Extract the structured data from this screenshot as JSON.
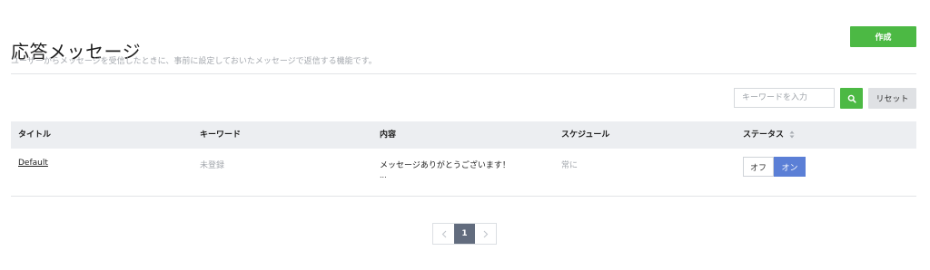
{
  "header": {
    "title": "応答メッセージ",
    "description": "ユーザーからメッセージを受信したときに、事前に設定しておいたメッセージで返信する機能です。",
    "create_label": "作成"
  },
  "search": {
    "placeholder": "キーワードを入力",
    "button_icon": "search-icon",
    "reset_label": "リセット"
  },
  "table": {
    "columns": [
      "タイトル",
      "キーワード",
      "内容",
      "スケジュール",
      "ステータス"
    ],
    "status_sort_icon": "sort-icon",
    "rows": [
      {
        "title": "Default",
        "keyword": "未登録",
        "content": "メッセージありがとうございます！",
        "content_more": "...",
        "schedule": "常に",
        "status_off": "オフ",
        "status_on": "オン",
        "status_selected": "オン"
      }
    ]
  },
  "pagination": {
    "prev_icon": "chevron-left-icon",
    "current_page": "1",
    "next_icon": "chevron-right-icon"
  },
  "colors": {
    "accent_green": "#4cb944",
    "toggle_on_blue": "#5b7fd6",
    "pager_current": "#626c7e",
    "header_bg": "#eceef1"
  }
}
